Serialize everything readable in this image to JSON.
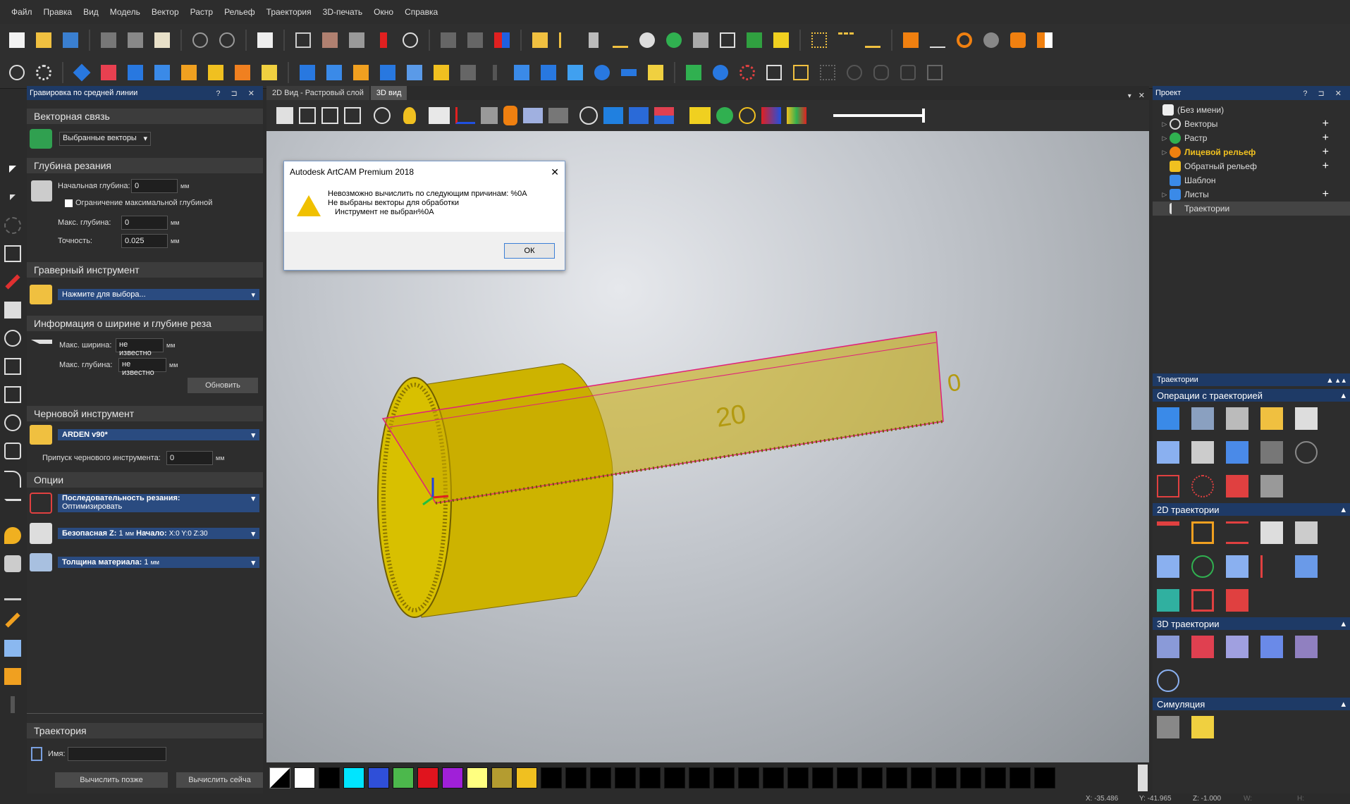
{
  "menu": [
    "Файл",
    "Правка",
    "Вид",
    "Модель",
    "Вектор",
    "Растр",
    "Рельеф",
    "Траектория",
    "3D-печать",
    "Окно",
    "Справка"
  ],
  "left_panel": {
    "title": "Гравировка по средней линии",
    "title_buttons": "? ⊐ ✕",
    "vector_link": {
      "section": "Векторная связь",
      "select_value": "Выбранные векторы"
    },
    "cut_depth": {
      "section": "Глубина резания",
      "start_depth_label": "Начальная глубина:",
      "start_depth_value": "0",
      "limit_checkbox_label": "Ограничение максимальной глубиной",
      "max_depth_label": "Макс. глубина:",
      "max_depth_value": "0",
      "precision_label": "Точность:",
      "precision_value": "0.025",
      "unit": "мм"
    },
    "engraving_tool": {
      "section": "Граверный инструмент",
      "select_value": "Нажмите для выбора..."
    },
    "width_depth_info": {
      "section": "Информация о ширине и глубине реза",
      "max_width_label": "Макс. ширина:",
      "max_width_value": "не известно",
      "max_depth_label": "Макс. глубина:",
      "max_depth_value": "не известно",
      "unit": "мм",
      "update_button": "Обновить"
    },
    "rough_tool": {
      "section": "Черновой инструмент",
      "select_value": "ARDEN v90*",
      "allowance_label": "Припуск чернового инструмента:",
      "allowance_value": "0",
      "unit": "мм"
    },
    "options": {
      "section": "Опции",
      "sequence_label": "Последовательность резания:",
      "sequence_value": "Оптимизировать",
      "safe_z_label": "Безопасная Z:",
      "safe_z_value": "1",
      "safe_z_unit": "мм",
      "start_label": "Начало:",
      "start_value": "X:0 Y:0 Z:30",
      "thickness_label": "Толщина материала:",
      "thickness_value": "1",
      "thickness_unit": "мм"
    },
    "toolpath": {
      "section": "Траектория",
      "name_label": "Имя:",
      "name_value": "",
      "calc_later_button": "Вычислить позже",
      "calc_now_button": "Вычислить сейча"
    }
  },
  "view_tabs": [
    "2D Вид - Растровый слой",
    "3D вид"
  ],
  "view_tab_close": "✕",
  "dialog": {
    "title": "Autodesk ArtCAM Premium 2018",
    "close": "✕",
    "line1": "Невозможно вычислить по следующим причинам: %0A",
    "line2": "Не выбраны векторы для обработки",
    "line3": "Инструмент не выбран%0A",
    "ok": "ОК"
  },
  "model_labels": [
    "20",
    "0"
  ],
  "palette_colors": [
    "#ffffff",
    "#000000",
    "#00e5ff",
    "#2f4fd8",
    "#4cb84c",
    "#e0141e",
    "#a020d8",
    "#ffff80",
    "#b49c30",
    "#f0c020",
    "#000000",
    "#000000",
    "#000000",
    "#000000",
    "#000000",
    "#000000",
    "#000000",
    "#000000",
    "#000000",
    "#000000",
    "#000000",
    "#000000",
    "#000000",
    "#000000",
    "#000000",
    "#000000",
    "#000000",
    "#000000",
    "#000000",
    "#000000",
    "#000000"
  ],
  "status": {
    "x": "X: -35.486",
    "y": "Y: -41.965",
    "z": "Z: -1.000",
    "w": "W:",
    "h": "H:"
  },
  "right_panel": {
    "project_title": "Проект",
    "project_buttons": "? ⊐ ✕",
    "tree": [
      {
        "label": "(Без имени)",
        "color": "#ddd"
      },
      {
        "label": "Векторы",
        "color": "#ddd"
      },
      {
        "label": "Растр",
        "color": "#ddd"
      },
      {
        "label": "Лицевой рельеф",
        "color": "#f0c020"
      },
      {
        "label": "Обратный рельеф",
        "color": "#ddd"
      },
      {
        "label": "Шаблон",
        "color": "#ddd"
      },
      {
        "label": "Листы",
        "color": "#ddd"
      },
      {
        "label": "Траектории",
        "color": "#ddd"
      }
    ],
    "toolpaths_title": "Траектории",
    "toolpath_ops": "Операции с траекторией",
    "tp2d": "2D траектории",
    "tp3d": "3D траектории",
    "simulation": "Симуляция"
  }
}
